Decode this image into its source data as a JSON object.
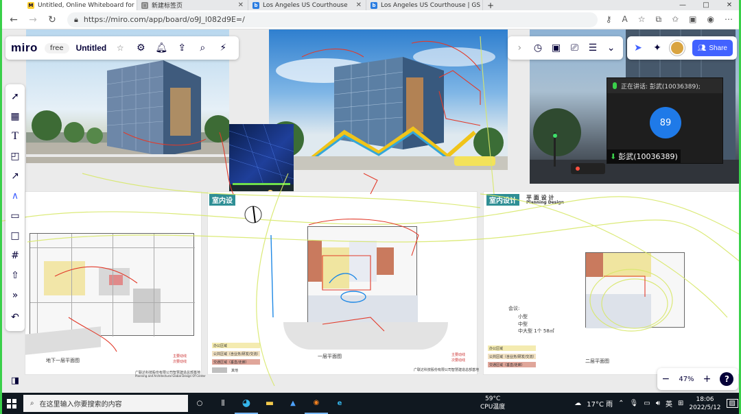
{
  "browser": {
    "tabs": [
      {
        "title": "Untitled, Online Whiteboard for",
        "active": true
      },
      {
        "title": "新建标签页",
        "active": false
      },
      {
        "title": "Los Angeles US Courthouse",
        "active": false
      },
      {
        "title": "Los Angeles US Courthouse | GS",
        "active": false
      }
    ],
    "new_tab": "+",
    "url": "https://miro.com/app/board/o9J_l082d9E=/",
    "window_controls": [
      "—",
      "□",
      "✕"
    ]
  },
  "miro": {
    "logo": "miro",
    "plan_badge": "free",
    "board_title": "Untitled",
    "share_label": "Share",
    "zoom_level": "47%",
    "zoom_out": "−",
    "zoom_in": "+",
    "help": "?"
  },
  "meeting": {
    "speaking_label": "正在讲话: 彭武(10036389);",
    "participant_count": "89",
    "speaker_name": "彭武(10036389)"
  },
  "sheets": {
    "sheet2_tag": "室内设",
    "sheet3_tag": "室内设计",
    "sheet3_title": "平 面 设 计",
    "sheet3_subtitle": "Planning Design",
    "sheet1_caption": "地下一层平面图",
    "sheet2_caption": "一层平面图",
    "sheet3_caption": "二层平面图",
    "legend_main": "主要动线",
    "legend_secondary": "次要动线",
    "legend_office": "办公区域",
    "legend_public": "公共区域（含业务/研发/交流）",
    "legend_flow": "交通区域（垂直/走廊）",
    "legend_other": "其他",
    "company_caption": "广联达科技股份有限公司智慧建造总部基地",
    "company_caption_en": "Planning and Architectural Global Design Of Center",
    "meeting_room_heading": "会议:",
    "meeting_room_small": "小型",
    "meeting_room_mid": "中型",
    "meeting_room_large": "中大型  1个   58㎡"
  },
  "taskbar": {
    "search_placeholder": "在这里输入你要搜索的内容",
    "cpu_temp": "59°C",
    "cpu_label": "CPU温度",
    "weather": "17°C  雨",
    "ime": "英",
    "time": "18:06",
    "date": "2022/5/12"
  }
}
